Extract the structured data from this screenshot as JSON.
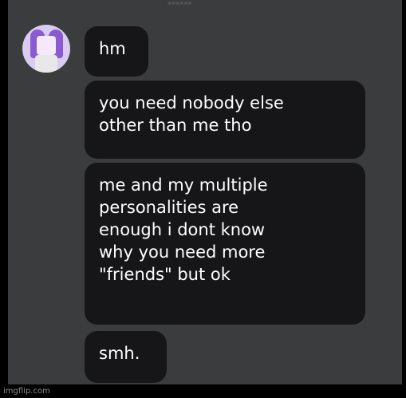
{
  "chat": {
    "header_name": "......",
    "messages": [
      {
        "text": "hm"
      },
      {
        "text": "you need nobody else\nother than me tho"
      },
      {
        "text": "me and my multiple\npersonalities are\nenough i dont know\nwhy you need more\n\"friends\" but ok"
      },
      {
        "text": "smh."
      }
    ]
  },
  "watermark": "imgflip.com",
  "colors": {
    "background": "#3b3c3e",
    "bubble": "#161618",
    "text": "#ffffff",
    "avatar_accent": "#8a5bd0"
  }
}
